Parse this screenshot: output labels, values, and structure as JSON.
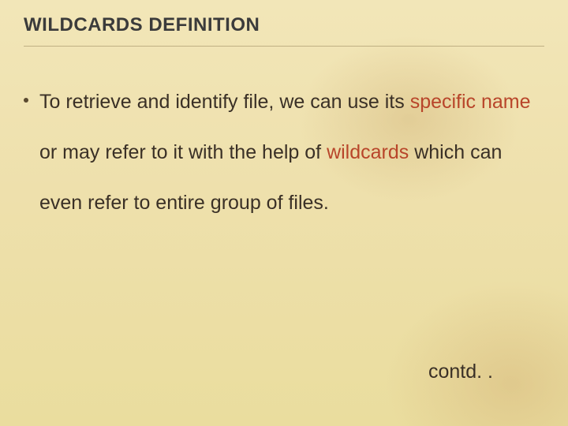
{
  "title": "WILDCARDS DEFINITION",
  "body": {
    "seg1": "To retrieve and identify file, we can use its ",
    "seg2_accent": "specific name",
    "seg3": " or may refer to it with the help of ",
    "seg4_accent": "wildcards",
    "seg5": " which can even refer to entire group of files."
  },
  "footer": "contd. ."
}
